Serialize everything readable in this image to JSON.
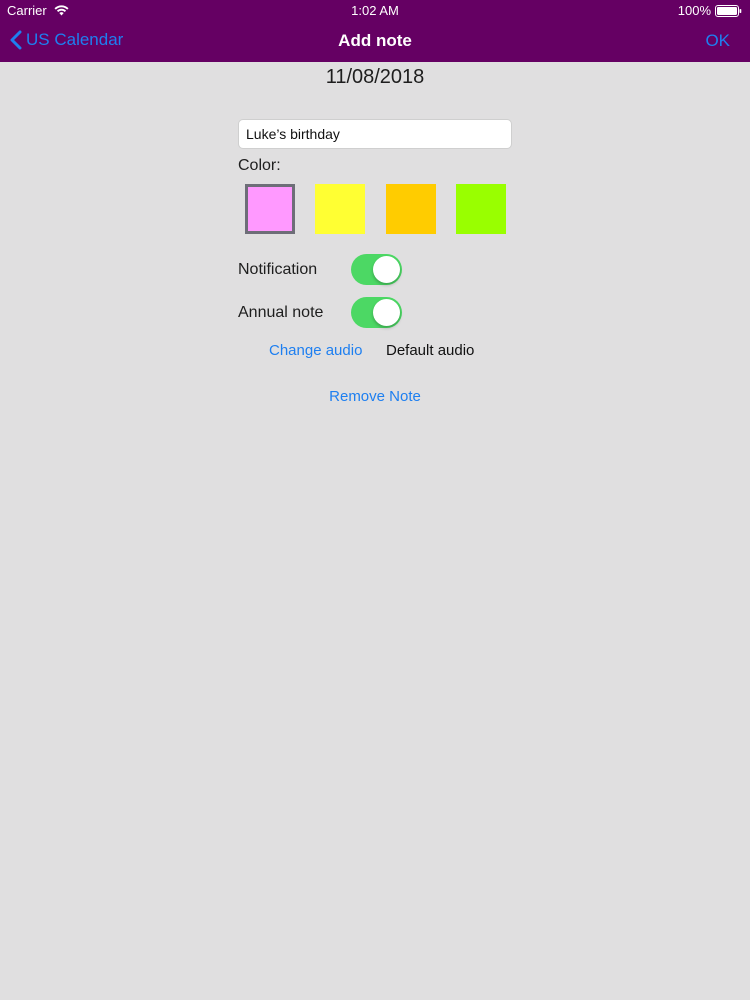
{
  "status_bar": {
    "carrier": "Carrier",
    "time": "1:02 AM",
    "battery": "100%",
    "wifi_icon": "wifi-icon",
    "battery_icon": "battery-icon"
  },
  "nav": {
    "back_label": "US Calendar",
    "title": "Add note",
    "ok_label": "OK",
    "back_icon": "chevron-left-icon"
  },
  "date": "11/08/2018",
  "note": {
    "value": "Luke’s birthday"
  },
  "color_section": {
    "label": "Color:",
    "swatches": [
      "#ff99ff",
      "#ffff33",
      "#ffcc00",
      "#99ff00"
    ],
    "selected_index": 0
  },
  "notification": {
    "label": "Notification",
    "on": true
  },
  "annual_note": {
    "label": "Annual note",
    "on": true
  },
  "audio": {
    "change_label": "Change audio",
    "value": "Default audio"
  },
  "remove_label": "Remove Note",
  "colors": {
    "header_bg": "#650063",
    "page_bg": "#e0dfe0",
    "accent": "#1e7ff0",
    "toggle_on": "#4cd864"
  }
}
